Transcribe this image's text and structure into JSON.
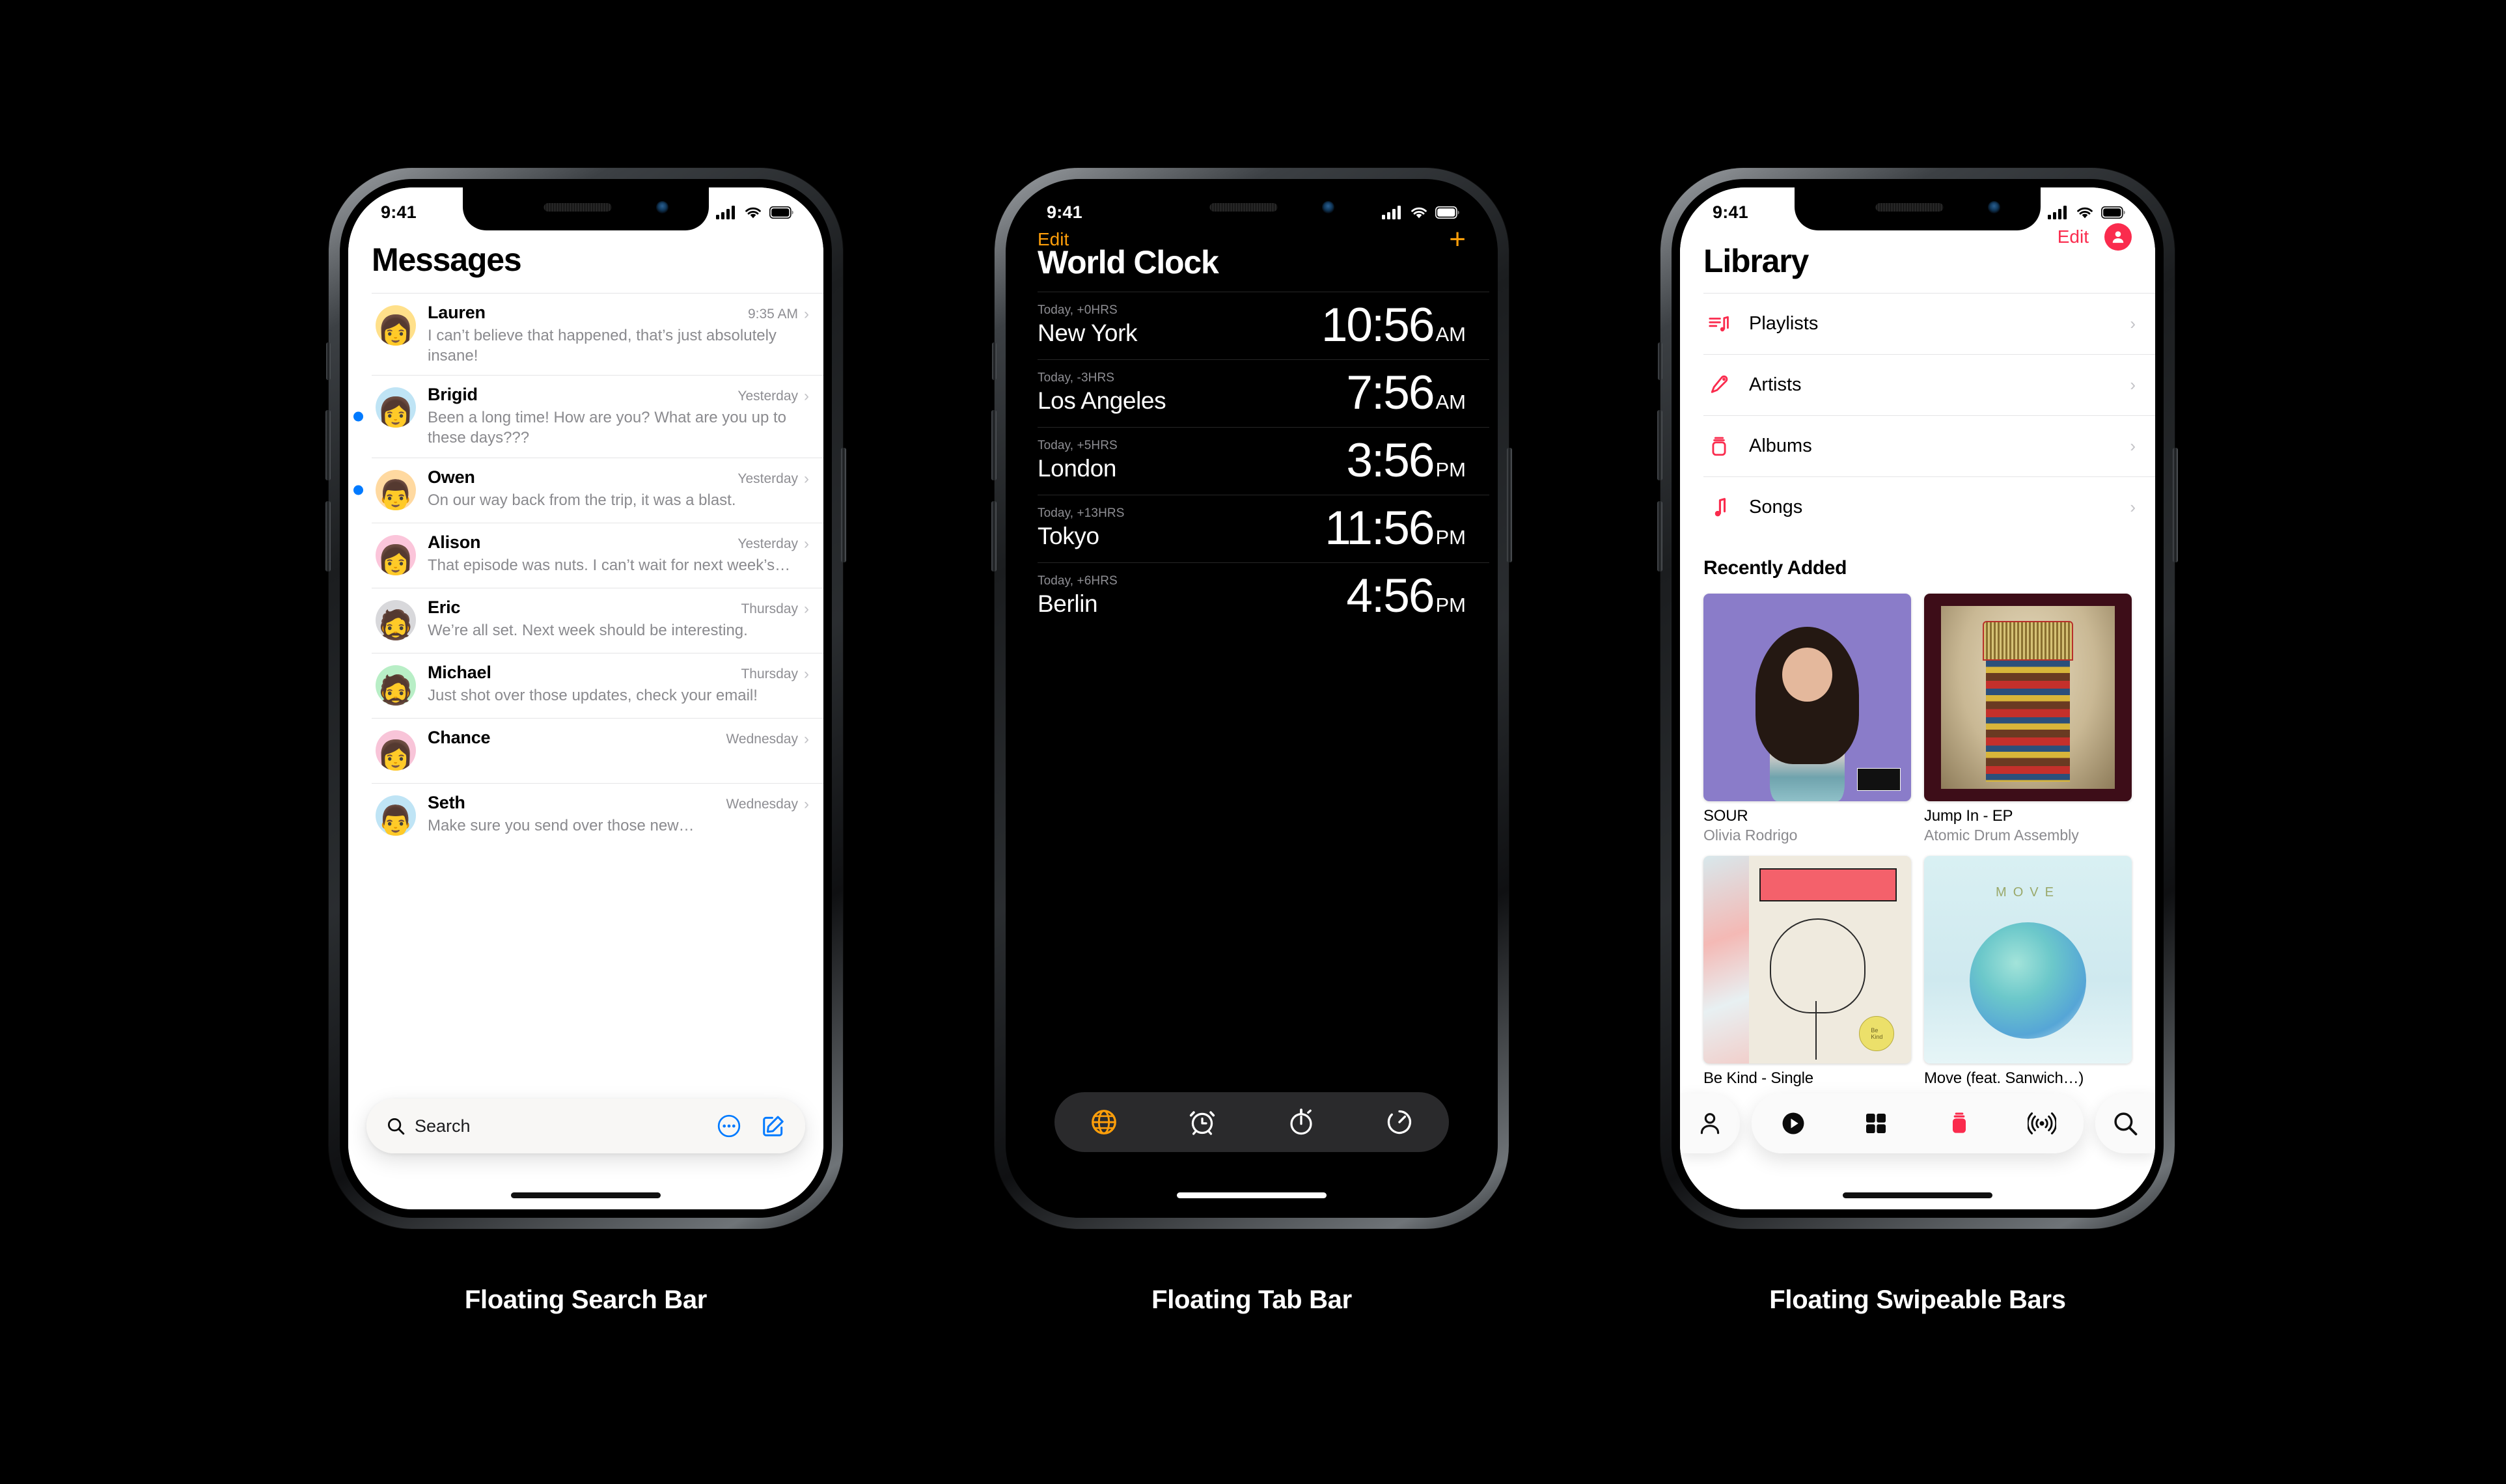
{
  "captions": [
    {
      "label": "Floating Search Bar"
    },
    {
      "label": "Floating Tab Bar"
    },
    {
      "label": "Floating Swipeable Bars"
    }
  ],
  "colors": {
    "messages_accent": "#007aff",
    "clock_accent": "#ff9f0a",
    "music_accent": "#fa2b4d",
    "background": "#000000"
  },
  "messages": {
    "status": {
      "time": "9:41"
    },
    "title": "Messages",
    "search": {
      "placeholder": "Search",
      "icon": "search-icon",
      "more_icon": "more-circle-icon",
      "compose_icon": "compose-icon"
    },
    "threads": [
      {
        "name": "Lauren",
        "time": "9:35 AM",
        "preview": "I can’t believe that happened, that’s just absolutely insane!",
        "unread": false,
        "avatar_bg": "#ffe08a",
        "emoji": "👩"
      },
      {
        "name": "Brigid",
        "time": "Yesterday",
        "preview": "Been a long time! How are you? What are you up to these days???",
        "unread": true,
        "avatar_bg": "#bfe4f5",
        "emoji": "👩"
      },
      {
        "name": "Owen",
        "time": "Yesterday",
        "preview": "On our way back from the trip, it was a blast.",
        "unread": true,
        "avatar_bg": "#ffd9a0",
        "emoji": "👨"
      },
      {
        "name": "Alison",
        "time": "Yesterday",
        "preview": "That episode was nuts. I can’t wait for next week’s…",
        "unread": false,
        "avatar_bg": "#fbc5da",
        "emoji": "👩"
      },
      {
        "name": "Eric",
        "time": "Thursday",
        "preview": "We’re all set. Next week should be interesting.",
        "unread": false,
        "avatar_bg": "#d8d8db",
        "emoji": "🧔"
      },
      {
        "name": "Michael",
        "time": "Thursday",
        "preview": "Just shot over those updates, check your email!",
        "unread": false,
        "avatar_bg": "#b8eec6",
        "emoji": "🧔"
      },
      {
        "name": "Chance",
        "time": "Wednesday",
        "preview": "",
        "unread": false,
        "avatar_bg": "#f8c4d8",
        "emoji": "👩"
      },
      {
        "name": "Seth",
        "time": "Wednesday",
        "preview": "Make sure you send over those new…",
        "unread": false,
        "avatar_bg": "#bfe4f5",
        "emoji": "👨"
      }
    ]
  },
  "world_clock": {
    "status": {
      "time": "9:41"
    },
    "nav": {
      "edit_label": "Edit",
      "add_label": "+"
    },
    "title": "World Clock",
    "clocks": [
      {
        "offset": "Today, +0HRS",
        "city": "New York",
        "time": "10:56",
        "meridiem": "AM"
      },
      {
        "offset": "Today, -3HRS",
        "city": "Los Angeles",
        "time": "7:56",
        "meridiem": "AM"
      },
      {
        "offset": "Today, +5HRS",
        "city": "London",
        "time": "3:56",
        "meridiem": "PM"
      },
      {
        "offset": "Today, +13HRS",
        "city": "Tokyo",
        "time": "11:56",
        "meridiem": "PM"
      },
      {
        "offset": "Today, +6HRS",
        "city": "Berlin",
        "time": "4:56",
        "meridiem": "PM"
      }
    ],
    "tabs": [
      {
        "name": "world-clock",
        "icon": "globe-icon",
        "active": true
      },
      {
        "name": "alarm",
        "icon": "alarm-icon",
        "active": false
      },
      {
        "name": "stopwatch",
        "icon": "stopwatch-icon",
        "active": false
      },
      {
        "name": "timer",
        "icon": "timer-icon",
        "active": false
      }
    ]
  },
  "library": {
    "status": {
      "time": "9:41"
    },
    "nav": {
      "edit_label": "Edit",
      "account_icon": "person-fill-icon"
    },
    "title": "Library",
    "rows": [
      {
        "label": "Playlists",
        "icon": "playlist-icon"
      },
      {
        "label": "Artists",
        "icon": "microphone-icon"
      },
      {
        "label": "Albums",
        "icon": "album-icon"
      },
      {
        "label": "Songs",
        "icon": "note-icon"
      }
    ],
    "section_title": "Recently Added",
    "albums": [
      {
        "name": "SOUR",
        "artist": "Olivia Rodrigo",
        "art": "sour"
      },
      {
        "name": "Jump In - EP",
        "artist": "Atomic Drum Assembly",
        "art": "jump"
      },
      {
        "name": "Be Kind - Single",
        "artist": "",
        "art": "bekind"
      },
      {
        "name": "Move (feat. Sanwich…)",
        "artist": "",
        "art": "move"
      }
    ],
    "bars": {
      "left": {
        "icon": "person-icon"
      },
      "right": {
        "icon": "search-icon"
      },
      "center": [
        {
          "name": "listen-now",
          "icon": "play-circle-icon",
          "active": false
        },
        {
          "name": "browse",
          "icon": "grid-icon",
          "active": false
        },
        {
          "name": "library",
          "icon": "album-icon",
          "active": true
        },
        {
          "name": "radio",
          "icon": "radio-icon",
          "active": false
        }
      ]
    }
  }
}
